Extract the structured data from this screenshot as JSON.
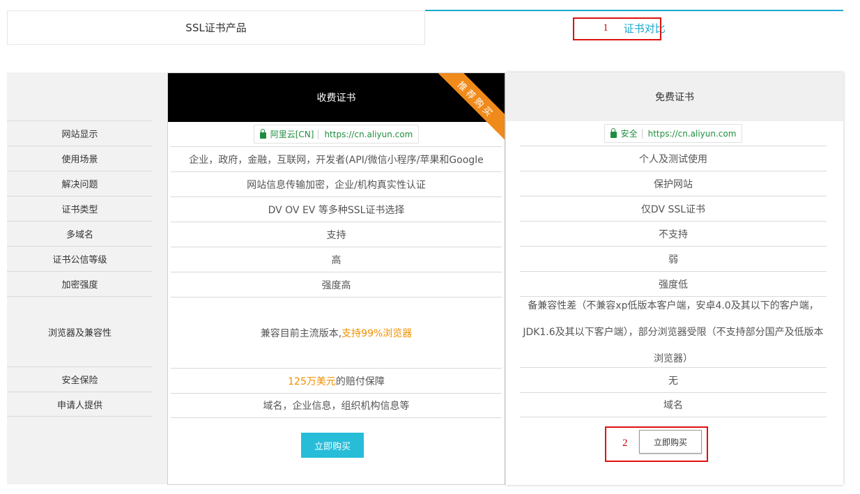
{
  "tabs": {
    "products": "SSL证书产品",
    "compare": "证书对比",
    "compare_marker": "1"
  },
  "row_labels": [
    "网站显示",
    "使用场景",
    "解决问题",
    "证书类型",
    "多域名",
    "证书公信等级",
    "加密强度",
    "浏览器及兼容性",
    "安全保险",
    "申请人提供"
  ],
  "paid": {
    "title": "收费证书",
    "ribbon": "推荐购买",
    "site_name": "阿里云[CN]",
    "url": "https://cn.aliyun.com",
    "use_case": "企业，政府，金融，互联网，开发者(API/微信小程序/苹果和Google",
    "problem": "网站信息传输加密，企业/机构真实性认证",
    "cert_type": "DV OV EV 等多种SSL证书选择",
    "multi_domain": "支持",
    "trust_level": "高",
    "encryption": "强度高",
    "browser_prefix": "兼容目前主流版本,",
    "browser_highlight": "支持99%浏览器",
    "insurance_highlight": "125万美元",
    "insurance_suffix": "的赔付保障",
    "applicant": "域名，企业信息，组织机构信息等",
    "buy_button": "立即购买"
  },
  "free": {
    "title": "免费证书",
    "site_name": "安全",
    "url": "https://cn.aliyun.com",
    "use_case": "个人及测试使用",
    "problem": "保护网站",
    "cert_type": "仅DV SSL证书",
    "multi_domain": "不支持",
    "trust_level": "弱",
    "encryption": "强度低",
    "browser": "备兼容性差（不兼容xp低版本客户端，安卓4.0及其以下的客户端，JDK1.6及其以下客户端），部分浏览器受限（不支持部分国产及低版本浏览器）",
    "insurance": "无",
    "applicant": "域名",
    "buy_button": "立即购买",
    "buy_marker": "2"
  },
  "colors": {
    "accent": "#1aa7d1",
    "buy_button": "#27bdd9",
    "highlight": "#f09000",
    "ribbon": "#f08a1a",
    "secure_green": "#1e8e3e",
    "annotation_red": "#e01010"
  },
  "icons": [
    "lock-icon"
  ]
}
